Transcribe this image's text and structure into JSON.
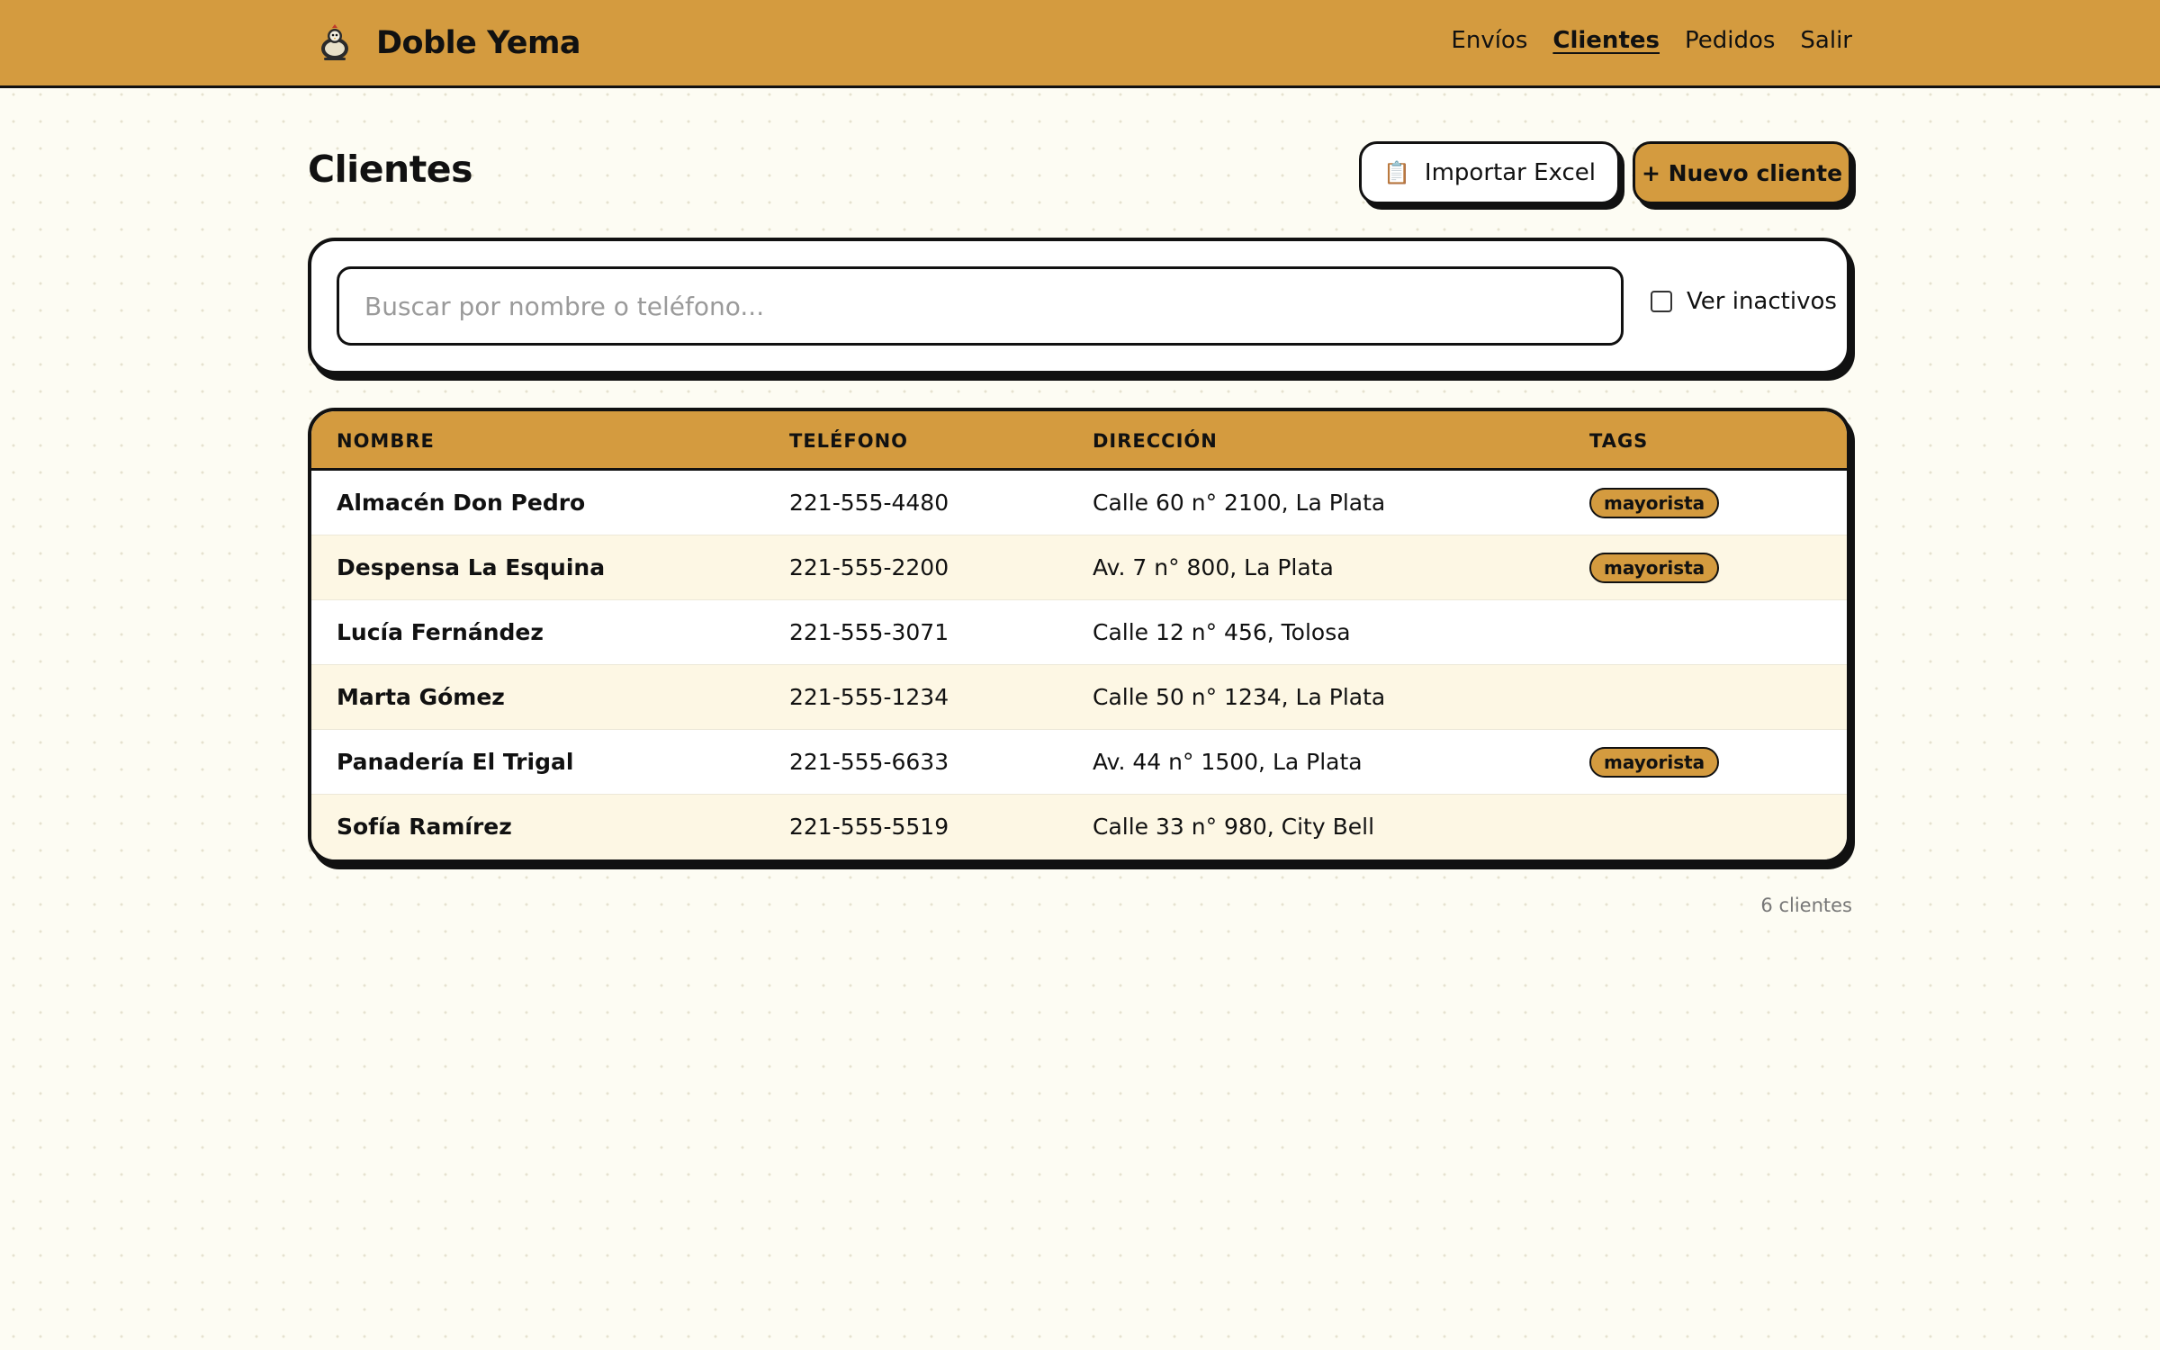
{
  "brand": {
    "name": "Doble Yema",
    "logo_icon": "chicken-icon"
  },
  "nav": {
    "items": [
      {
        "label": "Envíos",
        "active": false
      },
      {
        "label": "Clientes",
        "active": true
      },
      {
        "label": "Pedidos",
        "active": false
      },
      {
        "label": "Salir",
        "active": false
      }
    ]
  },
  "page": {
    "title": "Clientes",
    "import_label": "Importar Excel",
    "import_icon": "clipboard-icon",
    "new_label": "+ Nuevo cliente"
  },
  "search": {
    "placeholder": "Buscar por nombre o teléfono...",
    "value": "",
    "inactive_label": "Ver inactivos",
    "inactive_checked": false
  },
  "table": {
    "headers": {
      "name": "NOMBRE",
      "phone": "TELÉFONO",
      "address": "DIRECCIÓN",
      "tags": "TAGS"
    },
    "rows": [
      {
        "name": "Almacén Don Pedro",
        "phone": "221-555-4480",
        "address": "Calle 60 n° 2100, La Plata",
        "tag": "mayorista"
      },
      {
        "name": "Despensa La Esquina",
        "phone": "221-555-2200",
        "address": "Av. 7 n° 800, La Plata",
        "tag": "mayorista"
      },
      {
        "name": "Lucía Fernández",
        "phone": "221-555-3071",
        "address": "Calle 12 n° 456, Tolosa",
        "tag": ""
      },
      {
        "name": "Marta Gómez",
        "phone": "221-555-1234",
        "address": "Calle 50 n° 1234, La Plata",
        "tag": ""
      },
      {
        "name": "Panadería El Trigal",
        "phone": "221-555-6633",
        "address": "Av. 44 n° 1500, La Plata",
        "tag": "mayorista"
      },
      {
        "name": "Sofía Ramírez",
        "phone": "221-555-5519",
        "address": "Calle 33 n° 980, City Bell",
        "tag": ""
      }
    ]
  },
  "footer": {
    "count_text": "6 clientes"
  },
  "colors": {
    "accent": "#d49b3f",
    "background": "#fdfcf3",
    "row_alt": "#fdf7e4",
    "ink": "#111111"
  }
}
